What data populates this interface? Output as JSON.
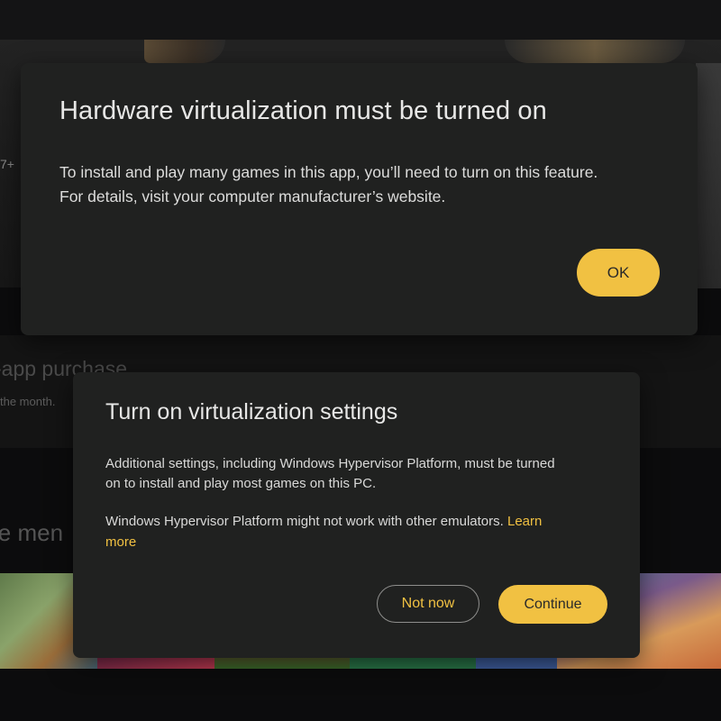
{
  "background": {
    "age_rating_fragment": "7+",
    "purchase_title_fragment": "-app purchase",
    "purchase_subtitle_fragment": "the month.",
    "more_title_fragment": "le men"
  },
  "dialog_hardware": {
    "title": "Hardware virtualization must be turned on",
    "body_lines": [
      "To install and play many games in this app, you’ll need to turn on this feature.",
      "For details, visit your computer manufacturer’s website."
    ],
    "ok_label": "OK"
  },
  "dialog_settings": {
    "title": "Turn on virtualization settings",
    "paragraph1_lines": [
      "Additional settings, including Windows Hypervisor Platform, must be turned",
      "on to install and play most games on this PC."
    ],
    "paragraph2_text": "Windows Hypervisor Platform might not work with other emulators.",
    "learn_more_part1": "Learn",
    "learn_more_part2": "more",
    "not_now_label": "Not now",
    "continue_label": "Continue"
  },
  "colors": {
    "accent": "#f1c142",
    "dialog_surface": "#202120",
    "backdrop": "#0c0c0d"
  }
}
